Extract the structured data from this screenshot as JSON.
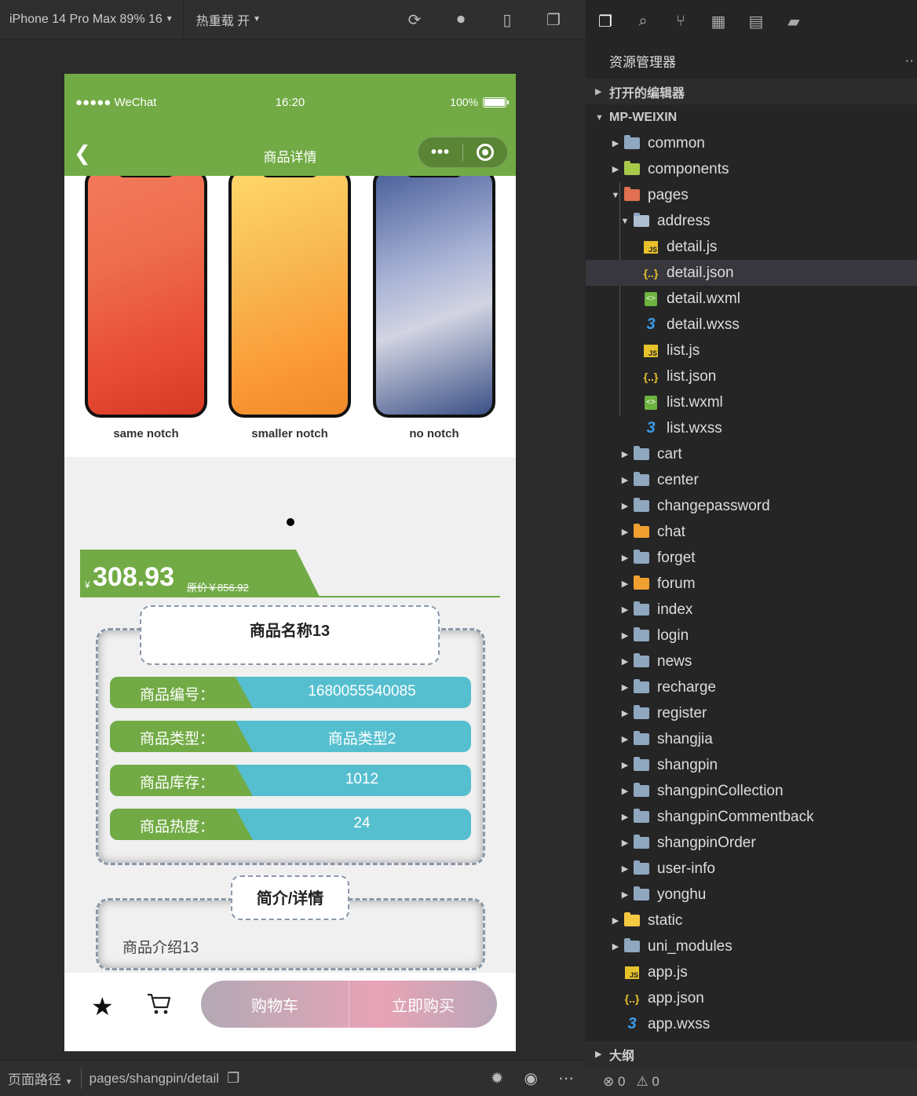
{
  "toolbar": {
    "device": "iPhone 14 Pro Max 89% 16",
    "hotreload": "热重载 开"
  },
  "phone": {
    "carrier": "●●●●● WeChat",
    "time": "16:20",
    "battery": "100%",
    "nav_title": "商品详情",
    "capsule_dots": "•••",
    "banner_labels": [
      "same notch",
      "smaller notch",
      "no notch"
    ],
    "price_symbol": "¥",
    "price": "308.93",
    "original_price": "原价￥856.92",
    "product_name": "商品名称13",
    "fields": [
      {
        "key": "商品编号：",
        "value": "1680055540085"
      },
      {
        "key": "商品类型：",
        "value": "商品类型2"
      },
      {
        "key": "商品库存：",
        "value": "1012"
      },
      {
        "key": "商品热度：",
        "value": "24"
      }
    ],
    "detail_title": "简介/详情",
    "intro": "商品介绍13",
    "add_cart": "购物车",
    "buy_now": "立即购买"
  },
  "footer": {
    "path_label": "页面路径",
    "path": "pages/shangpin/detail"
  },
  "explorer": {
    "title": "资源管理器",
    "open_editors": "打开的编辑器",
    "project": "MP-WEIXIN",
    "items": {
      "common": "common",
      "components": "components",
      "pages": "pages",
      "address": "address",
      "detail_js": "detail.js",
      "detail_json": "detail.json",
      "detail_wxml": "detail.wxml",
      "detail_wxss": "detail.wxss",
      "list_js": "list.js",
      "list_json": "list.json",
      "list_wxml": "list.wxml",
      "list_wxss": "list.wxss",
      "cart": "cart",
      "center": "center",
      "changepassword": "changepassword",
      "chat": "chat",
      "forget": "forget",
      "forum": "forum",
      "index": "index",
      "login": "login",
      "news": "news",
      "recharge": "recharge",
      "register": "register",
      "shangjia": "shangjia",
      "shangpin": "shangpin",
      "shangpinCollection": "shangpinCollection",
      "shangpinCommentback": "shangpinCommentback",
      "shangpinOrder": "shangpinOrder",
      "user_info": "user-info",
      "yonghu": "yonghu",
      "static": "static",
      "uni_modules": "uni_modules",
      "app_js": "app.js",
      "app_json": "app.json",
      "app_wxss": "app.wxss"
    },
    "outline": "大纲",
    "errors": "0",
    "warnings": "0"
  }
}
